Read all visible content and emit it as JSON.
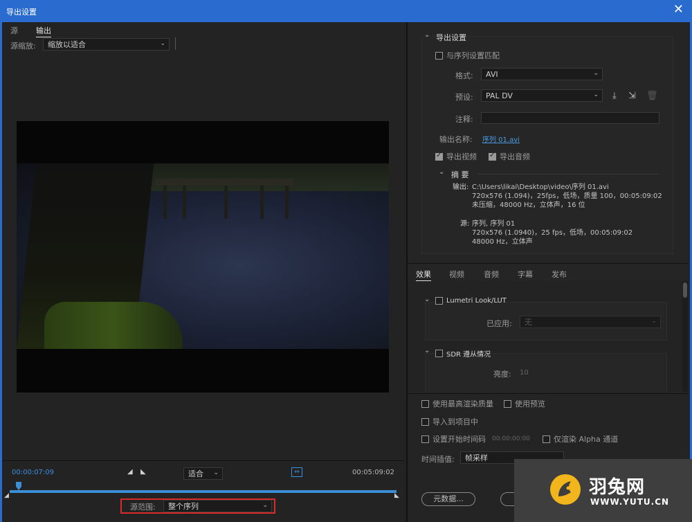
{
  "window": {
    "title": "导出设置",
    "close_icon": "close-icon"
  },
  "left": {
    "tabs": [
      "源",
      "输出"
    ],
    "active_tab": 1,
    "source_scale": {
      "label": "源缩放:",
      "value": "缩放以适合"
    },
    "timeline": {
      "current_time": "00:00:07:09",
      "end_time": "00:05:09:02",
      "fit": "适合",
      "range_label": "源范围:",
      "range_value": "整个序列"
    }
  },
  "export_settings": {
    "heading": "导出设置",
    "match_sequence": "与序列设置匹配",
    "format_label": "格式:",
    "format_value": "AVI",
    "preset_label": "预设:",
    "preset_value": "PAL DV",
    "comment_label": "注释:",
    "output_name_label": "输出名称:",
    "output_name_value": "序列 01.avi",
    "export_video": "导出视频",
    "export_audio": "导出音频",
    "summary": {
      "heading": "摘 要",
      "output_label": "输出:",
      "output_lines": [
        "C:\\Users\\likai\\Desktop\\video\\序列 01.avi",
        "720x576 (1.094)，25fps，低场，质量 100，00:05:09:02",
        "未压缩，48000 Hz，立体声，16 位"
      ],
      "source_label": "源:",
      "source_lines": [
        "序列, 序列 01",
        "720x576 (1.0940)，25 fps，低场，00:05:09:02",
        "48000 Hz，立体声"
      ]
    }
  },
  "right_tabs": [
    "效果",
    "视频",
    "音频",
    "字幕",
    "发布"
  ],
  "effects": {
    "lumetri": "Lumetri Look/LUT",
    "applied_label": "已应用:",
    "applied_value": "无",
    "sdr": "SDR 遵从情况",
    "brightness_label": "亮度:",
    "brightness_value": "10"
  },
  "bottom": {
    "max_quality": "使用最高渲染质量",
    "use_preview": "使用预览",
    "import_project": "导入到项目中",
    "set_start_tc": "设置开始时间码",
    "start_tc_value": "00:00:00:00",
    "alpha_only": "仅渲染 Alpha 通道",
    "interp_label": "时间插值:",
    "interp_value": "帧采样",
    "metadata_button": "元数据..."
  },
  "watermark": {
    "name": "羽兔网",
    "url": "WWW.YUTU.CN",
    "color": "#f2b51c"
  }
}
